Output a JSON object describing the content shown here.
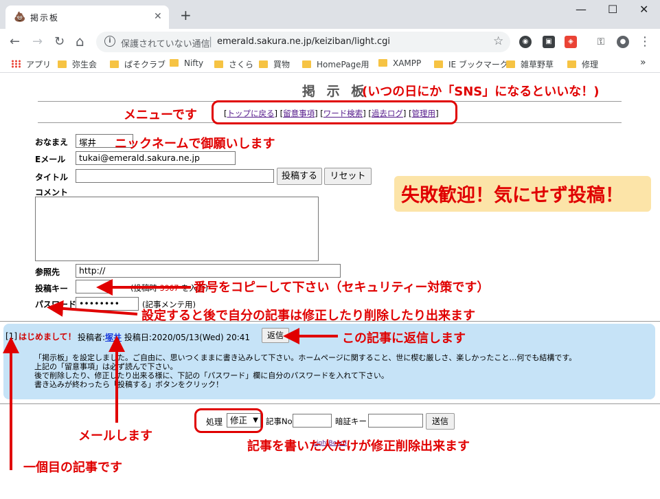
{
  "browser": {
    "tab_title": "掲示板",
    "tab_favicon": "💩",
    "close_glyph": "✕",
    "newtab_glyph": "+",
    "window": {
      "minimize": "—",
      "maximize": "☐",
      "close": "✕"
    },
    "nav": {
      "back": "←",
      "forward": "→",
      "reload": "↻",
      "home": "⌂"
    },
    "not_secure": "保護されていない通信",
    "url": "emerald.sakura.ne.jp/keiziban/light.cgi",
    "star_glyph": "☆",
    "menu_glyph": "⋮",
    "bookmarks_more": "»",
    "bookmarks": [
      "アプリ",
      "弥生会",
      "ぱそクラブ",
      "Nifty",
      "さくら",
      "買物",
      "HomePage用",
      "XAMPP",
      "IE ブックマーク",
      "雑草野草",
      "修理"
    ]
  },
  "board": {
    "title": "掲 示 板",
    "menu": {
      "open": "[",
      "items": [
        "トップに戻る",
        "留意事項",
        "ワード検索",
        "過去ログ",
        "管理用"
      ],
      "sep": "] [",
      "close": "]"
    }
  },
  "form": {
    "name_label": "おなまえ",
    "name_value": "塚井",
    "email_label": "Eメール",
    "email_value": "tukai@emerald.sakura.ne.jp",
    "title_label": "タイトル",
    "title_value": "",
    "submit_label": "投稿する",
    "reset_label": "リセット",
    "comment_label": "コメント",
    "url_label": "参照先",
    "url_value": "http://",
    "key_label": "投稿キー",
    "key_hint_prefix": "(投稿時",
    "key_number": "3967",
    "key_hint_suffix": "を入力)",
    "password_label": "パスワード",
    "password_value": "••••••••",
    "password_hint": "(記事メンテ用)"
  },
  "post": {
    "number": "[1]",
    "subject": "はじめまして！",
    "author_label": "投稿者:",
    "author": "塚井",
    "date_label": "投稿日:",
    "date": "2020/05/13(Wed) 20:41",
    "reply_label": "返信",
    "body": [
      "「掲示板」を設定しました。ご自由に、思いつくままに書き込みして下さい。ホームページに関すること、世に楔む厳しさ、楽しかったこと…何でも結構です。",
      "上記の「留意事項」は必ず読んで下さい。",
      "後で削除したり、修正したり出来る様に、下記の「パスワード」欄に自分のパスワードを入れて下さい。",
      "書き込みが終わったら「投稿する」ボタンをクリック！"
    ]
  },
  "maintenance": {
    "action_label": "処理",
    "action_value": "修正",
    "record_label": "記事No",
    "pass_label": "暗証キー",
    "send_label": "送信",
    "footer": "LightBoard"
  },
  "annotations": {
    "title_note": "(いつの日にか「SNS」になるといいな！)",
    "menu_note": "メニューです",
    "nickname_note": "ニックネームで御願いします",
    "welcome_note": "失敗歓迎！気にせず投稿！",
    "key_note": "番号をコピーして下さい（セキュリティー対策です）",
    "password_note": "設定すると後で自分の記事は修正したり削除したり出来ます",
    "reply_note": "この記事に返信します",
    "mail_note": "メールします",
    "first_note": "一個目の記事です",
    "owner_note": "記事を書いた人だけが修正削除出来ます"
  },
  "colors": {
    "annotation": "#e00000",
    "post_bg": "#c6e3f7",
    "callout_bg": "#fce4a8"
  }
}
